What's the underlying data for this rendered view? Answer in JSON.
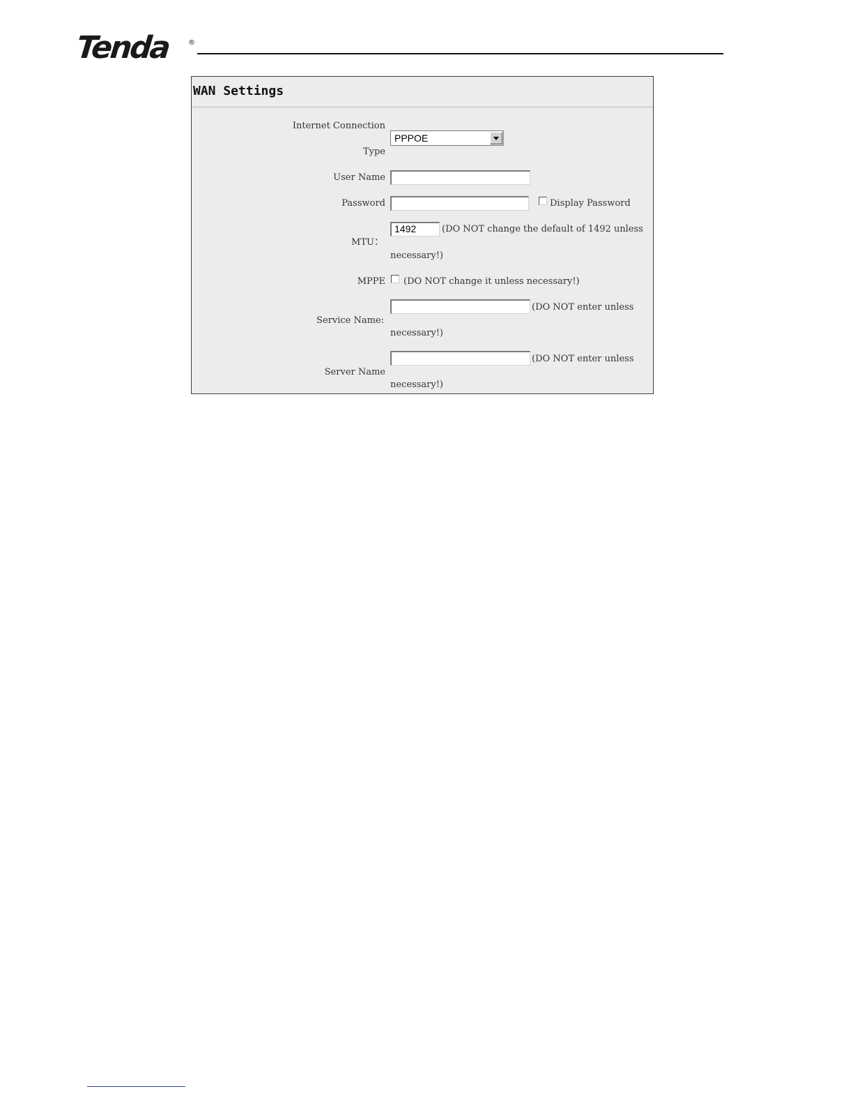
{
  "header": {
    "logo_text": "Tenda",
    "logo_mark": "®"
  },
  "panel": {
    "title": "WAN Settings",
    "connection_type": {
      "label_line1": "Internet Connection",
      "label_line2": "Type",
      "selected_value": "PPPOE"
    },
    "user_name": {
      "label": "User Name",
      "value": ""
    },
    "password": {
      "label": "Password",
      "value": "",
      "display_password_label": "Display Password",
      "display_password_checked": false
    },
    "mtu": {
      "label": "MTU：",
      "value": "1492",
      "note_line1": "(DO NOT change the default of 1492 unless",
      "note_line2": "necessary!)"
    },
    "mppe": {
      "label": "MPPE",
      "checked": false,
      "note": "(DO NOT change it unless necessary!)"
    },
    "service_name": {
      "label": "Service Name:",
      "value": "",
      "note_line1": "(DO NOT enter unless",
      "note_line2": "necessary!)"
    },
    "server_name": {
      "label": "Server Name",
      "value": "",
      "note_line1": "(DO NOT enter unless",
      "note_line2": "necessary!)"
    }
  }
}
